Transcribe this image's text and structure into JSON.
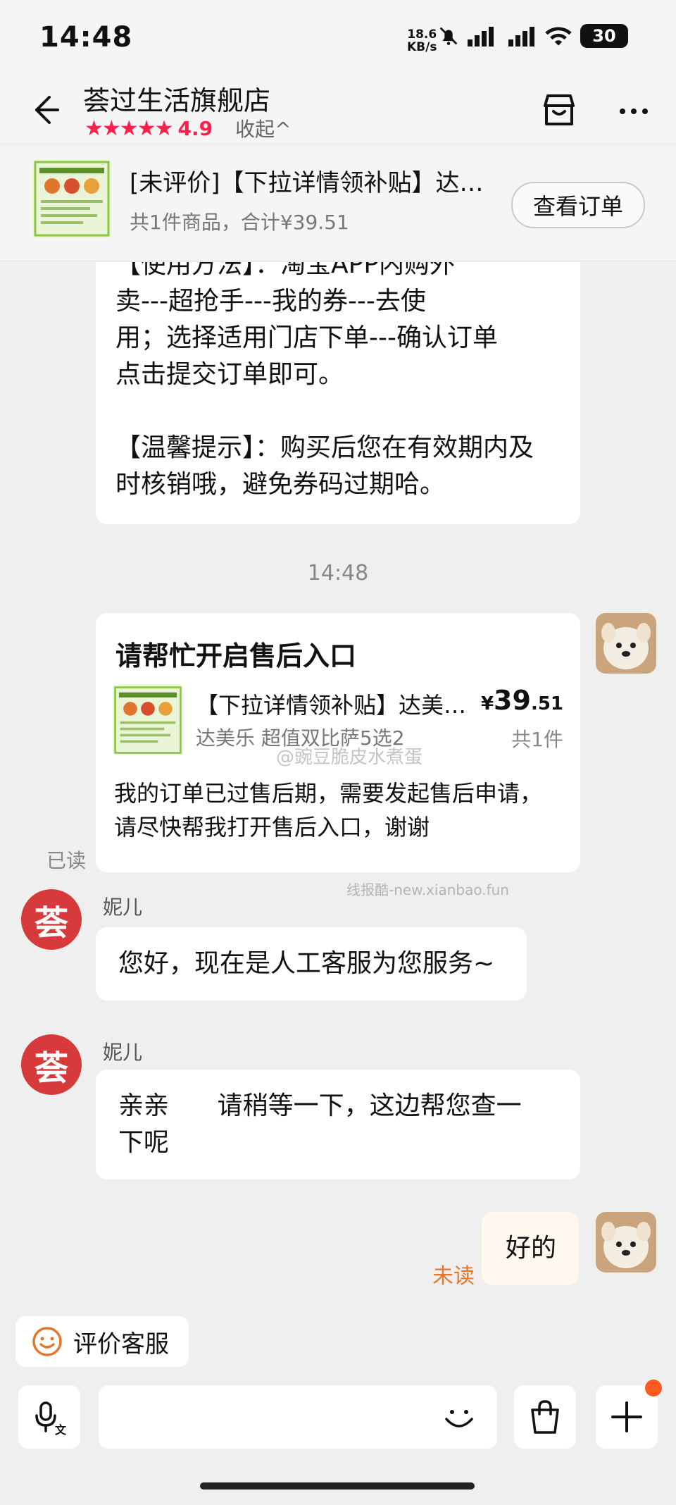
{
  "status_bar": {
    "time": "14:48",
    "net_speed_value": "18.6",
    "net_speed_unit": "KB/s",
    "battery": "30"
  },
  "header": {
    "shop_name": "荟过生活旗舰店",
    "rating": "4.9",
    "collapse": "收起^"
  },
  "order_bar": {
    "title": "[未评价]【下拉详情领补贴】达…",
    "subtitle": "共1件商品，合计¥39.51",
    "view_order": "查看订单"
  },
  "messages": {
    "agent_long_text": "【使用方法】：淘宝APP内购外\n卖---超抢手---我的券---去使\n用；选择适用门店下单---确认订单\n点击提交订单即可。\n\n【温馨提示】：购买后您在有效期内及\n时核销哦，避免券码过期哈。",
    "timestamp": "14:48",
    "user_card_title": "请帮忙开启售后入口",
    "product_name": "【下拉详情领补贴】达美…",
    "product_variant": "达美乐 超值双比萨5选2",
    "price_symbol": "¥",
    "price_int": "39",
    "price_dec": ".51",
    "quantity": "共1件",
    "user_card_body": "我的订单已过售后期，需要发起售后申请，\n请尽快帮我打开售后入口，谢谢",
    "read_status": "已读",
    "agent_name_1": "妮儿",
    "agent_msg_1": "您好，现在是人工客服为您服务~",
    "agent_name_2": "妮儿",
    "agent_msg_2": "亲亲      请稍等一下，这边帮您查一\n下呢",
    "user_msg": "好的",
    "unread_status": "未读",
    "agent_avatar_char": "荟"
  },
  "watermarks": {
    "site": "线报酷-new.xianbao.fun",
    "weibo": "@豌豆脆皮水煮蛋"
  },
  "bottom": {
    "rate_service": "评价客服"
  },
  "colors": {
    "accent_red": "#ff1f4b",
    "agent_avatar": "#d63a3a",
    "unread_orange": "#e5762b",
    "price_black": "#111111"
  }
}
